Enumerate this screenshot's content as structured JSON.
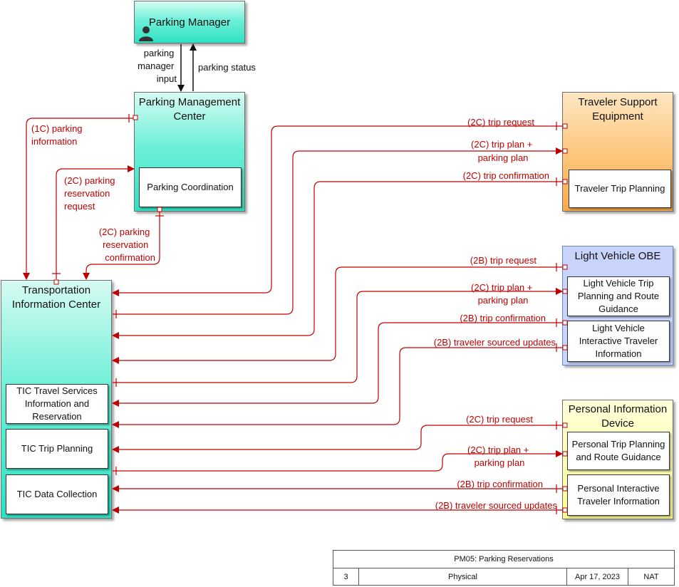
{
  "nodes": {
    "parking_manager": "Parking Manager",
    "pmc": "Parking Management\nCenter",
    "pmc_parking_coordination": "Parking Coordination",
    "tic": "Transportation\nInformation Center",
    "tic_travel_services": "TIC Travel Services\nInformation and\nReservation",
    "tic_trip_planning": "TIC Trip Planning",
    "tic_data_collection": "TIC Data Collection",
    "tse": "Traveler Support\nEquipment",
    "tse_trip_planning": "Traveler Trip Planning",
    "lvobe": "Light Vehicle OBE",
    "lvobe_trip_planning": "Light Vehicle Trip\nPlanning and Route\nGuidance",
    "lvobe_interactive": "Light Vehicle\nInteractive Traveler\nInformation",
    "pid": "Personal Information\nDevice",
    "pid_trip_planning": "Personal Trip Planning\nand Route Guidance",
    "pid_interactive": "Personal Interactive\nTraveler Information"
  },
  "flows": {
    "manager_input": [
      "parking",
      "manager",
      "input"
    ],
    "parking_status": "parking status",
    "parking_information": [
      "(1C) parking",
      "information"
    ],
    "reservation_request": [
      "(2C) parking",
      "reservation",
      "request"
    ],
    "reservation_confirmation": [
      "(2C) parking",
      "reservation",
      "confirmation"
    ],
    "tse_trip_request": "(2C) trip request",
    "tse_trip_plan": [
      "(2C) trip plan +",
      "parking plan"
    ],
    "tse_trip_confirmation": "(2C) trip confirmation",
    "lv_trip_request": "(2B) trip request",
    "lv_trip_plan": [
      "(2C) trip plan +",
      "parking plan"
    ],
    "lv_trip_confirmation": "(2B) trip confirmation",
    "lv_traveler_updates": "(2B) traveler sourced updates",
    "pid_trip_request": "(2C) trip request",
    "pid_trip_plan": [
      "(2C) trip plan +",
      "parking plan"
    ],
    "pid_trip_confirmation": "(2B) trip confirmation",
    "pid_traveler_updates": "(2B) traveler sourced updates"
  },
  "footer": {
    "title": "PM05: Parking Reservations",
    "number": "3",
    "view": "Physical",
    "date": "Apr 17, 2023",
    "tag": "NAT"
  },
  "colors": {
    "flow": "#c00000",
    "center": "#2fe0c3",
    "support": "#f9a84e",
    "vehicle": "#c8d4fb",
    "personal": "#fbfb96"
  }
}
